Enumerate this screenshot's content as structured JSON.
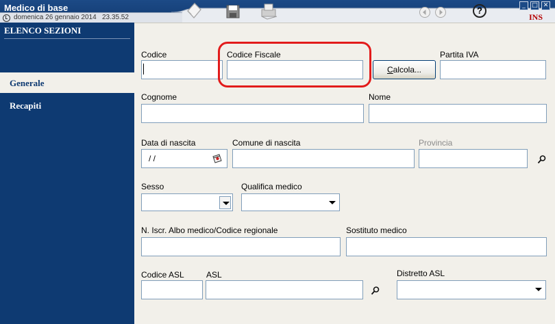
{
  "window": {
    "title": "Medico di base",
    "date": "domenica 26 gennaio 2014",
    "time": "23.35.52",
    "mode": "INS"
  },
  "toolbar": {
    "icons": [
      "eraser-icon",
      "save-icon",
      "print-icon",
      "nav-back-icon",
      "nav-forward-icon",
      "help-icon"
    ],
    "help_label": "?"
  },
  "sidebar": {
    "title": "ELENCO SEZIONI",
    "items": [
      {
        "label": "Generale",
        "active": true
      },
      {
        "label": "Recapiti",
        "active": false
      }
    ]
  },
  "form": {
    "codice": {
      "label": "Codice",
      "value": ""
    },
    "codice_fiscale": {
      "label": "Codice Fiscale",
      "value": ""
    },
    "calcola_button": {
      "label_u": "C",
      "label_rest": "alcola..."
    },
    "partita_iva": {
      "label": "Partita IVA",
      "value": ""
    },
    "cognome": {
      "label": "Cognome",
      "value": ""
    },
    "nome": {
      "label": "Nome",
      "value": ""
    },
    "data_nascita": {
      "label": "Data di nascita",
      "value": "/ /"
    },
    "comune_nascita": {
      "label": "Comune di nascita",
      "value": ""
    },
    "provincia": {
      "label": "Provincia",
      "value": ""
    },
    "sesso": {
      "label": "Sesso",
      "value": ""
    },
    "qualifica": {
      "label": "Qualifica medico",
      "value": ""
    },
    "iscrizione": {
      "label": "N. Iscr. Albo medico/Codice regionale",
      "value": ""
    },
    "sostituto": {
      "label": "Sostituto medico",
      "value": ""
    },
    "codice_asl": {
      "label": "Codice ASL",
      "value": ""
    },
    "asl": {
      "label": "ASL",
      "value": ""
    },
    "distretto": {
      "label": "Distretto ASL",
      "value": ""
    }
  },
  "colors": {
    "title_bar": "#1c4a86",
    "sidebar": "#0e3a72",
    "form_bg": "#f2f0ea",
    "highlight": "#e21b1b",
    "mode_text": "#b40000"
  }
}
